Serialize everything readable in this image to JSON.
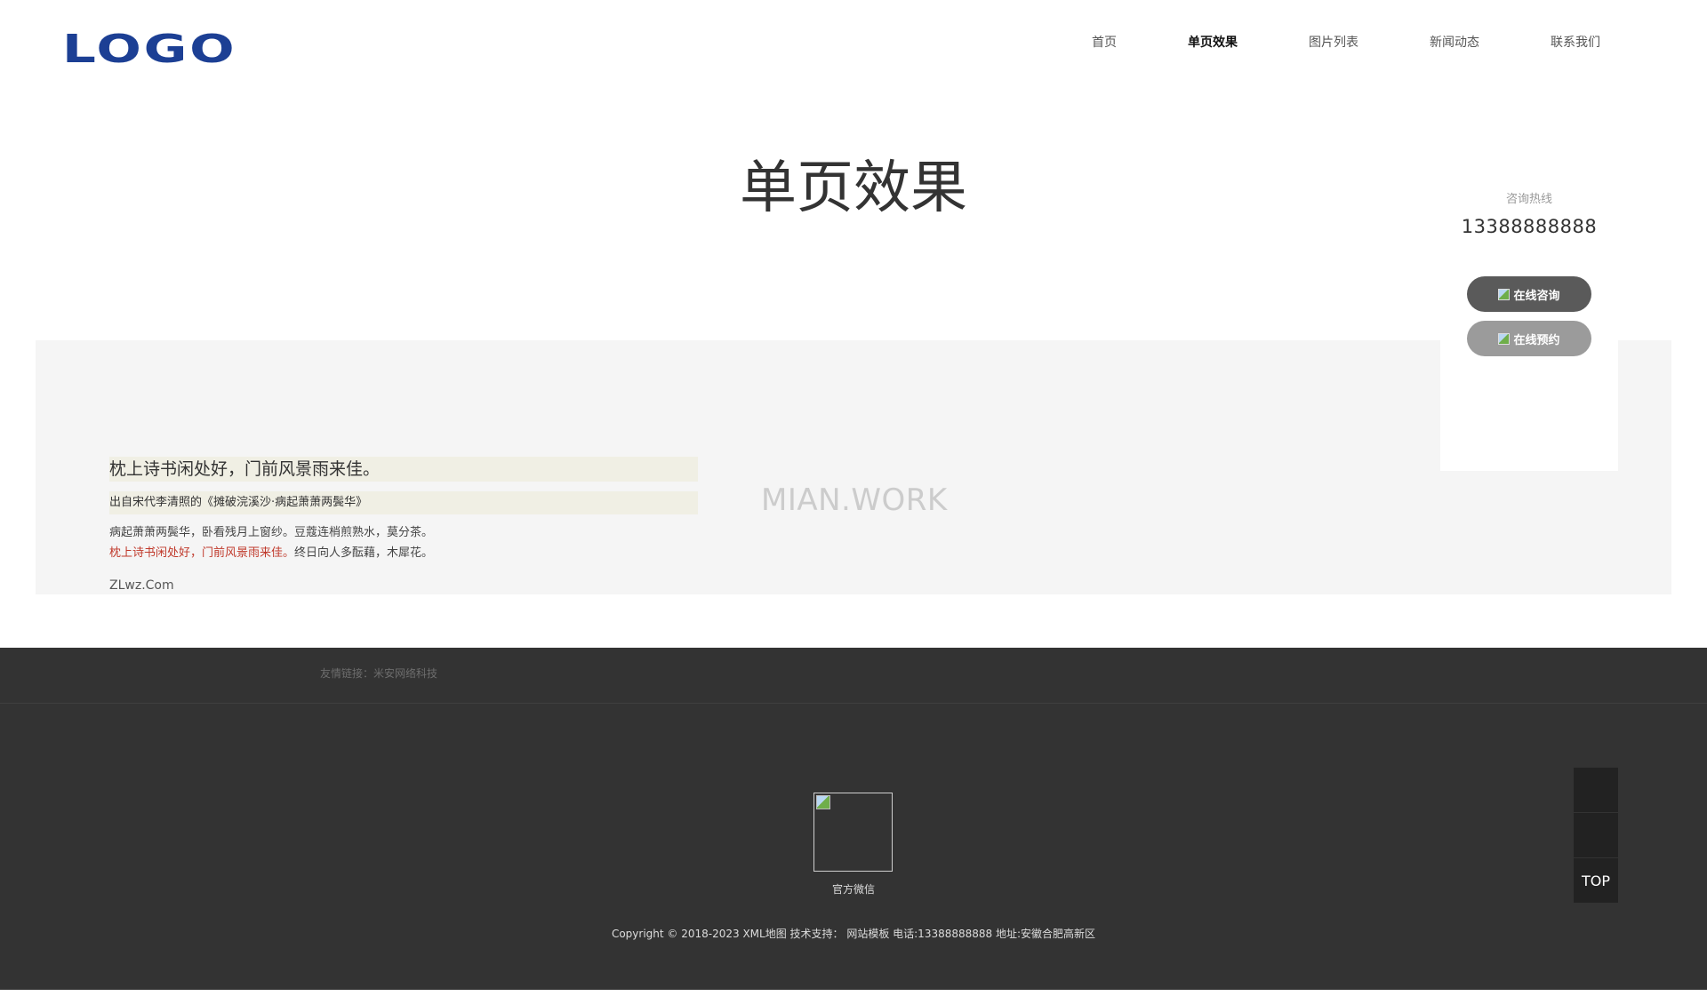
{
  "header": {
    "logo_text": "LOGO",
    "nav": [
      {
        "label": "首页",
        "active": false
      },
      {
        "label": "单页效果",
        "active": true
      },
      {
        "label": "图片列表",
        "active": false
      },
      {
        "label": "新闻动态",
        "active": false
      },
      {
        "label": "联系我们",
        "active": false
      }
    ]
  },
  "page": {
    "title": "单页效果"
  },
  "side_panel": {
    "hotline_label": "咨询热线",
    "hotline_number": "13388888888",
    "consult_label": "在线咨询",
    "reserve_label": "在线预约"
  },
  "content": {
    "poem_title": "枕上诗书闲处好，门前风景雨来佳。",
    "poem_source": "出自宋代李清照的《摊破浣溪沙·病起萧萧两鬓华》",
    "line1": "病起萧萧两鬓华，卧看残月上窗纱。豆蔻连梢煎熟水，莫分茶。",
    "line2_highlight": "枕上诗书闲处好，门前风景雨来佳。",
    "line2_rest": "终日向人多酝藉，木犀花。",
    "watermark": "MIAN.WORK",
    "site_text": "ZLwz.Com"
  },
  "footer": {
    "friend_links": "友情链接：米安网络科技",
    "qr_caption": "官方微信",
    "copyright": "Copyright © 2018-2023 XML地图 技术支持： 网站模板 电话:13388888888 地址:安徽合肥高新区"
  },
  "side_tools": {
    "top_label": "TOP"
  },
  "colors": {
    "logo": "#1c3f94",
    "footer_bg": "#333333",
    "content_band": "#f5f5f5",
    "highlight_red": "#c0392b",
    "consult_btn": "#5a5a5a",
    "reserve_btn": "#9b9b9b"
  }
}
